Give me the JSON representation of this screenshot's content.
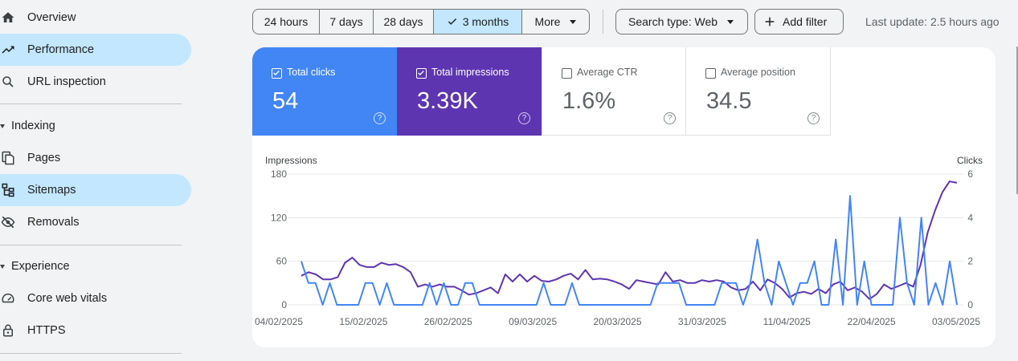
{
  "sidebar": {
    "items": [
      {
        "label": "Overview",
        "icon": "home-icon",
        "active": false
      },
      {
        "label": "Performance",
        "icon": "trending-up-icon",
        "active": true
      },
      {
        "label": "URL inspection",
        "icon": "search-icon",
        "active": false
      },
      {
        "section": "Indexing"
      },
      {
        "label": "Pages",
        "icon": "pages-icon",
        "active": false
      },
      {
        "label": "Sitemaps",
        "icon": "sitemap-icon",
        "active": true
      },
      {
        "label": "Removals",
        "icon": "eye-off-icon",
        "active": false
      },
      {
        "section": "Experience"
      },
      {
        "label": "Core web vitals",
        "icon": "speedometer-icon",
        "active": false
      },
      {
        "label": "HTTPS",
        "icon": "lock-icon",
        "active": false
      }
    ]
  },
  "toolbar": {
    "ranges": [
      "24 hours",
      "7 days",
      "28 days",
      "3 months",
      "More"
    ],
    "selected_range": "3 months",
    "search_type": "Search type: Web",
    "add_filter": "Add filter",
    "last_update": "Last update: 2.5 hours ago"
  },
  "metrics": [
    {
      "label": "Total clicks",
      "value": "54",
      "checked": true,
      "color": "#4285f4"
    },
    {
      "label": "Total impressions",
      "value": "3.39K",
      "checked": true,
      "color": "#5e35b1"
    },
    {
      "label": "Average CTR",
      "value": "1.6%",
      "checked": false,
      "color": "#ffffff"
    },
    {
      "label": "Average position",
      "value": "34.5",
      "checked": false,
      "color": "#ffffff"
    }
  ],
  "chart_data": {
    "type": "line",
    "left_axis_title": "Impressions",
    "right_axis_title": "Clicks",
    "left_ticks": [
      "180",
      "120",
      "60",
      "0"
    ],
    "right_ticks": [
      "6",
      "4",
      "2",
      "0"
    ],
    "ylim_left": [
      0,
      180
    ],
    "ylim_right": [
      0,
      6
    ],
    "x_tick_labels": [
      "04/02/2025",
      "15/02/2025",
      "26/02/2025",
      "09/03/2025",
      "20/03/2025",
      "31/03/2025",
      "11/04/2025",
      "22/04/2025",
      "03/05/2025"
    ],
    "x_start": "04/02/2025",
    "x_end": "03/05/2025",
    "series": [
      {
        "name": "Total impressions",
        "axis": "left",
        "color": "#5e35b1",
        "values": [
          40,
          45,
          42,
          35,
          35,
          38,
          58,
          65,
          55,
          52,
          52,
          58,
          55,
          56,
          52,
          45,
          25,
          28,
          25,
          28,
          25,
          25,
          20,
          14,
          16,
          20,
          24,
          16,
          42,
          32,
          42,
          32,
          40,
          33,
          32,
          35,
          40,
          43,
          35,
          48,
          35,
          36,
          35,
          32,
          28,
          22,
          34,
          32,
          30,
          28,
          45,
          32,
          34,
          30,
          30,
          34,
          32,
          34,
          32,
          24,
          20,
          22,
          32,
          20,
          35,
          30,
          22,
          10,
          16,
          18,
          15,
          22,
          16,
          28,
          32,
          20,
          24,
          18,
          8,
          15,
          28,
          22,
          26,
          30,
          25,
          55,
          100,
          130,
          155,
          170,
          168
        ]
      },
      {
        "name": "Total clicks",
        "axis": "right",
        "color": "#4285f4",
        "values": [
          2,
          1,
          1,
          0,
          1,
          0,
          0,
          0,
          0,
          1,
          1,
          0,
          1,
          0,
          0,
          0,
          0,
          0,
          1,
          0,
          1,
          0,
          0,
          1,
          1,
          0,
          0,
          0,
          0,
          0,
          0,
          0,
          0,
          0,
          1,
          0,
          0,
          0,
          1,
          0,
          0,
          0,
          0,
          0,
          0,
          0,
          0,
          0,
          0,
          0,
          1,
          1,
          1,
          1,
          0,
          0,
          0,
          0,
          0,
          1,
          1,
          1,
          0,
          1,
          3,
          1,
          0,
          2,
          1,
          0,
          1,
          1,
          2,
          0,
          0,
          3,
          0,
          5,
          0,
          2,
          0,
          0,
          0,
          0,
          4,
          1,
          0,
          4,
          0,
          1,
          0,
          2,
          0
        ]
      }
    ]
  }
}
